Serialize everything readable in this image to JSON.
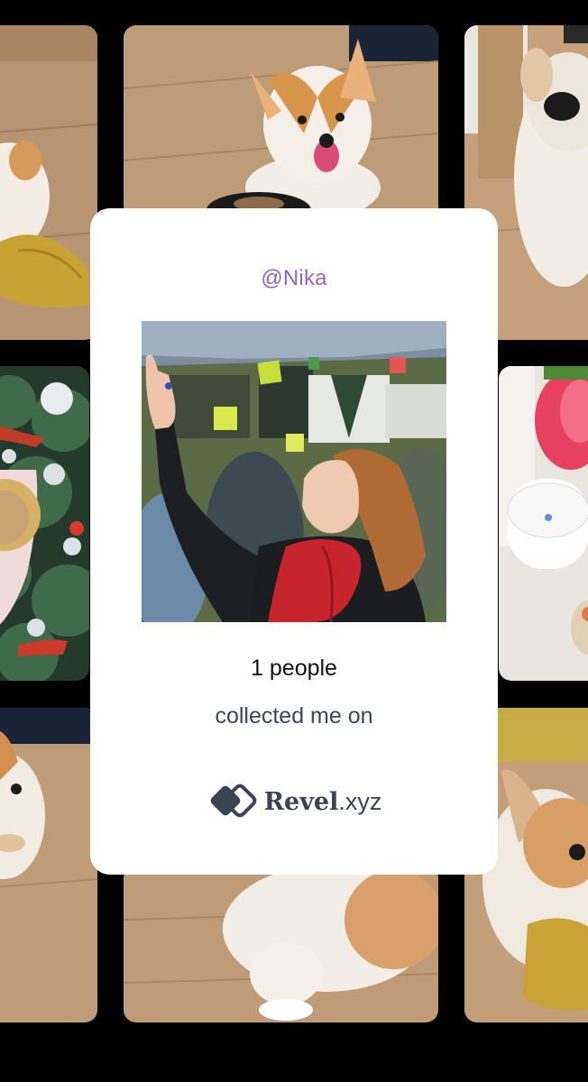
{
  "card": {
    "handle": "@Nika",
    "count_text": "1 people",
    "collected_text": "collected me on",
    "brand": {
      "name": "Revel",
      "tld": ".xyz"
    },
    "photo": "woman-with-red-scarf-reaching-up"
  },
  "background_tiles": [
    "corgi-with-yellow-toy",
    "corgi-licking-nose",
    "corgi-looking-up",
    "christmas-tree-with-cup",
    "tulip-and-candle",
    "corgi-sitting",
    "corgi-back",
    "corgi-with-yellow-toy-2"
  ],
  "colors": {
    "card_bg": "#ffffff",
    "handle_gradient_start": "#6b5bd2",
    "handle_gradient_end": "#e87a5d",
    "brand_color": "#3b4250",
    "page_bg": "#000000"
  }
}
